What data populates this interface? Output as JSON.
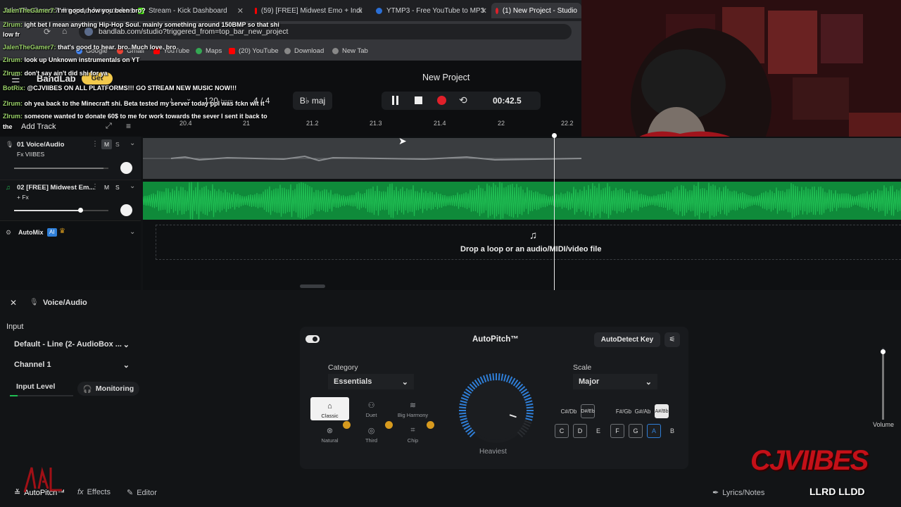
{
  "browser": {
    "tabs": [
      {
        "label": "JalenTheGamer7: I'm good, how you been bro?"
      },
      {
        "label": "Stream - Kick Dashboard"
      },
      {
        "label": "(59) [FREE] Midwest Emo + Indi"
      },
      {
        "label": "YTMP3 - Free YouTube to MP3"
      },
      {
        "label": "(1) New Project - Studio"
      }
    ],
    "url": "bandlab.com/studio?triggered_from=top_bar_new_project",
    "bookmarks": [
      "Google",
      "Gmail",
      "YouTube",
      "Maps",
      "(20) YouTube",
      "Download",
      "New Tab"
    ]
  },
  "chat": [
    {
      "user": "JalenTheGamer7:",
      "msg": "I'm good, how you been bro?"
    },
    {
      "user": "ZIrum:",
      "msg": "ight bet I mean anything Hip-Hop Soul. mainly something around 150BMP so that shi"
    },
    {
      "user": "",
      "msg": "low fr"
    },
    {
      "user": "JalenTheGamer7:",
      "msg": "that's good to hear. bro. Much love. bro"
    },
    {
      "user": "ZIrum:",
      "msg": "look up Unknown instrumentals on YT"
    },
    {
      "user": "ZIrum:",
      "msg": "don't say ain't did shi for ya"
    },
    {
      "user": "BotRix:",
      "msg": "@CJVIIBES ON ALL PLATFORMS!!! GO STREAM NEW MUSIC NOW!!!"
    },
    {
      "user": "ZIrum:",
      "msg": "oh yea back to the Minecraft shi. Beta tested my server today ppl was fckn wit it"
    },
    {
      "user": "ZIrum:",
      "msg": "someone wanted to donate 60$ to me for work towards the sever I sent it back to"
    },
    {
      "user": "",
      "msg": "the"
    }
  ],
  "app": {
    "logo": "BandLab",
    "get_label": "Get",
    "project_title": "New Project",
    "bpm": "120",
    "bpm_unit": "bpm",
    "time_sig_num": "4",
    "time_sig_den": "4",
    "key": "B♭ maj",
    "time": "00:42.5",
    "add_track": "Add Track",
    "ruler": [
      "20.4",
      "21",
      "21.2",
      "21.3",
      "21.4",
      "22",
      "22.2"
    ],
    "tracks": [
      {
        "num": "01",
        "name": "Voice/Audio",
        "fx": "Fx VIIBES",
        "mute": "M",
        "solo": "S",
        "volume": 0.95
      },
      {
        "num": "02",
        "name": "[FREE] Midwest Em...",
        "fx": "+ Fx",
        "mute": "M",
        "solo": "S",
        "volume": 0.7
      }
    ],
    "automix": "AutoMix",
    "ai": "AI",
    "drop_text": "Drop a loop or an audio/MIDI/video file"
  },
  "panel": {
    "track_name": "Voice/Audio",
    "input_label": "Input",
    "input_device": "Default - Line (2- AudioBox ...",
    "channel": "Channel 1",
    "input_level": "Input Level",
    "input_level_value": 0.12,
    "monitoring": "Monitoring",
    "autopitch": {
      "title": "AutoPitch™",
      "autodetect": "AutoDetect Key",
      "category_label": "Category",
      "category": "Essentials",
      "presets": [
        "Classic",
        "Duet",
        "Big Harmony",
        "Natural",
        "Third",
        "Chip"
      ],
      "selected_preset": "Classic",
      "knob_label": "Heaviest",
      "knob_value": 0.9,
      "scale_label": "Scale",
      "scale": "Major",
      "accidentals": [
        "C#/Db",
        "D#/Eb",
        "F#/Gb",
        "G#/Ab",
        "A#/Bb"
      ],
      "naturals": [
        "C",
        "D",
        "E",
        "F",
        "G",
        "A",
        "B"
      ]
    },
    "volume_label": "Volume",
    "volume_value": 0.95,
    "bottom_tabs": [
      "AutoPitch™",
      "Effects",
      "Editor"
    ],
    "lyrics": "Lyrics/Notes"
  },
  "overlay": {
    "watermark": "CJVIIBES",
    "ticker": "LLRD LLDD"
  },
  "colors": {
    "track_green": "#1fbd52",
    "record_red": "#e0202a",
    "accent_blue": "#2f7fd8",
    "badge_gold": "#d79a1e"
  }
}
